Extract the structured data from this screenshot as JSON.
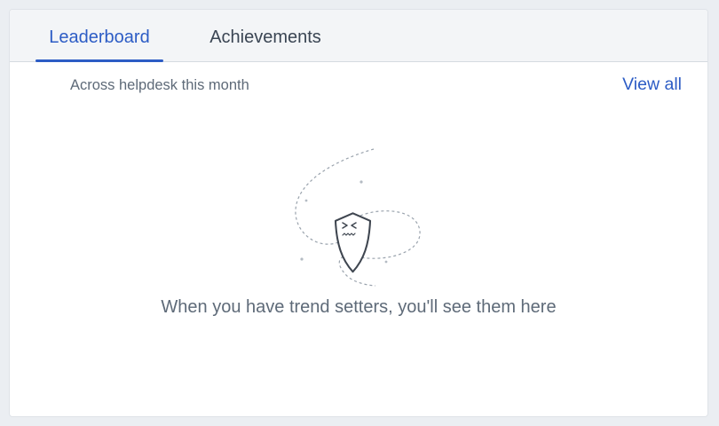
{
  "tabs": [
    {
      "label": "Leaderboard",
      "active": true
    },
    {
      "label": "Achievements",
      "active": false
    }
  ],
  "header": {
    "subtitle": "Across helpdesk this month",
    "view_all_label": "View all"
  },
  "empty_state": {
    "icon": "shield-sad-face-icon",
    "message": "When you have trend setters, you'll see them here"
  },
  "colors": {
    "accent": "#2c5cc5",
    "text_secondary": "#5e6a78",
    "tabbar_bg": "#f3f5f7",
    "page_bg": "#ebeef2"
  }
}
